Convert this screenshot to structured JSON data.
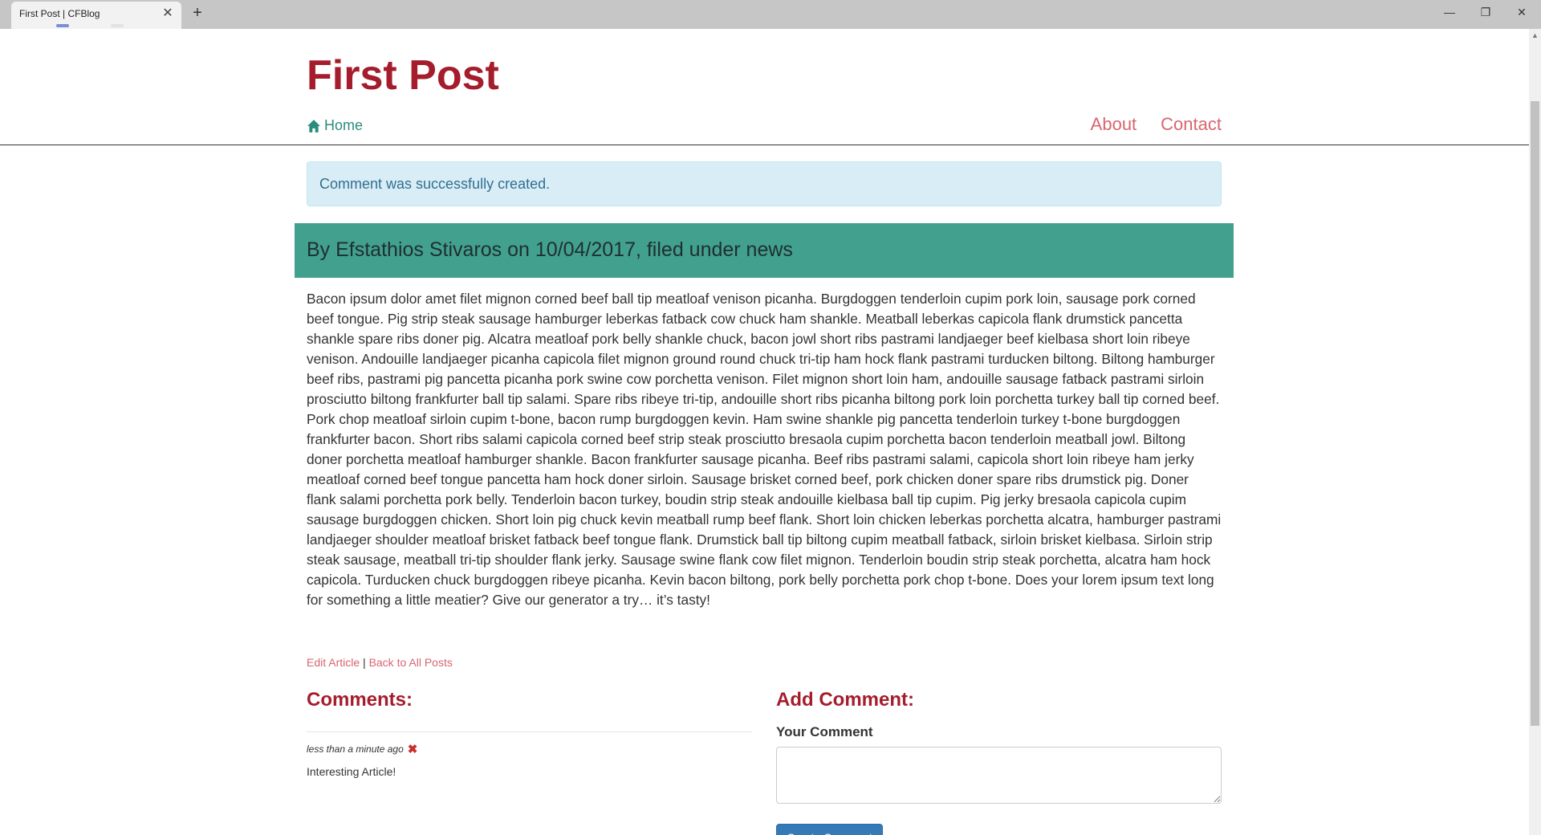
{
  "browser": {
    "tab_title": "First Post | CFBlog",
    "tab_close": "✕",
    "new_tab": "+",
    "win_minimize": "—",
    "win_maximize": "❐",
    "win_close": "✕"
  },
  "site": {
    "title": "First Post",
    "nav": {
      "home": "Home",
      "about": "About",
      "contact": "Contact"
    }
  },
  "alert": {
    "message": "Comment was successfully created."
  },
  "post": {
    "byline": "By Efstathios Stivaros on 10/04/2017, filed under news",
    "body": "Bacon ipsum dolor amet filet mignon corned beef ball tip meatloaf venison picanha. Burgdoggen tenderloin cupim pork loin, sausage pork corned beef tongue. Pig strip steak sausage hamburger leberkas fatback cow chuck ham shankle. Meatball leberkas capicola flank drumstick pancetta shankle spare ribs doner pig. Alcatra meatloaf pork belly shankle chuck, bacon jowl short ribs pastrami landjaeger beef kielbasa short loin ribeye venison. Andouille landjaeger picanha capicola filet mignon ground round chuck tri-tip ham hock flank pastrami turducken biltong. Biltong hamburger beef ribs, pastrami pig pancetta picanha pork swine cow porchetta venison. Filet mignon short loin ham, andouille sausage fatback pastrami sirloin prosciutto biltong frankfurter ball tip salami. Spare ribs ribeye tri-tip, andouille short ribs picanha biltong pork loin porchetta turkey ball tip corned beef. Pork chop meatloaf sirloin cupim t-bone, bacon rump burgdoggen kevin. Ham swine shankle pig pancetta tenderloin turkey t-bone burgdoggen frankfurter bacon. Short ribs salami capicola corned beef strip steak prosciutto bresaola cupim porchetta bacon tenderloin meatball jowl. Biltong doner porchetta meatloaf hamburger shankle. Bacon frankfurter sausage picanha. Beef ribs pastrami salami, capicola short loin ribeye ham jerky meatloaf corned beef tongue pancetta ham hock doner sirloin. Sausage brisket corned beef, pork chicken doner spare ribs drumstick pig. Doner flank salami porchetta pork belly. Tenderloin bacon turkey, boudin strip steak andouille kielbasa ball tip cupim. Pig jerky bresaola capicola cupim sausage burgdoggen chicken. Short loin pig chuck kevin meatball rump beef flank. Short loin chicken leberkas porchetta alcatra, hamburger pastrami landjaeger shoulder meatloaf brisket fatback beef tongue flank. Drumstick ball tip biltong cupim meatball fatback, sirloin brisket kielbasa. Sirloin strip steak sausage, meatball tri-tip shoulder flank jerky. Sausage swine flank cow filet mignon. Tenderloin boudin strip steak porchetta, alcatra ham hock capicola. Turducken chuck burgdoggen ribeye picanha. Kevin bacon biltong, pork belly porchetta pork chop t-bone. Does your lorem ipsum text long for something a little meatier? Give our generator a try… it’s tasty!",
    "edit_link": "Edit Article",
    "separator": "|",
    "back_link": "Back to All Posts"
  },
  "comments": {
    "heading": "Comments:",
    "items": [
      {
        "time": "less than a minute ago",
        "remove_glyph": "✖",
        "text": "Interesting Article!"
      }
    ]
  },
  "add_comment": {
    "heading": "Add Comment:",
    "label": "Your Comment",
    "textarea_value": "",
    "submit_label": "Create Comment"
  },
  "colors": {
    "brand": "#a51d2d",
    "link": "#d9656f",
    "teal": "#42a08f",
    "alert_bg": "#d9edf7",
    "button": "#337ab7"
  },
  "icons": {
    "home": "home-icon",
    "remove": "remove-icon"
  }
}
